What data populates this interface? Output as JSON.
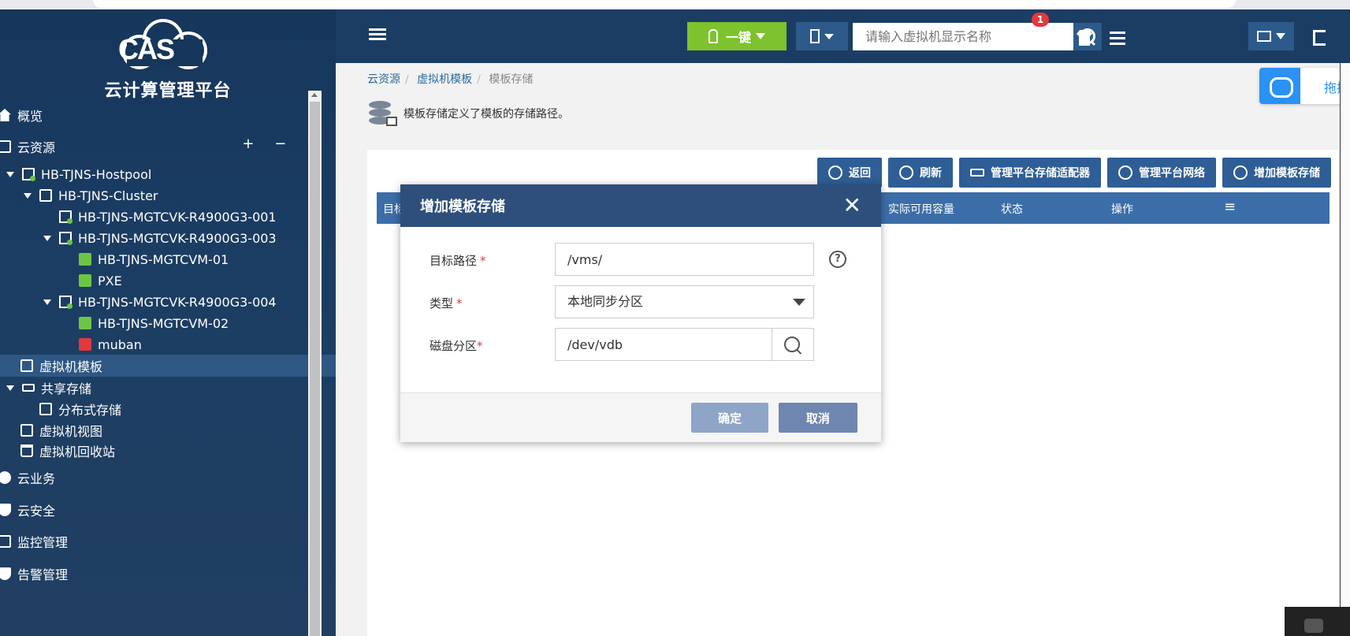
{
  "app": {
    "logo_text": "CAS",
    "subtitle": "云计算管理平台"
  },
  "header": {
    "one_key_label": "一键",
    "search_placeholder": "请输入虚拟机显示名称",
    "alert_count": "1"
  },
  "sidebar": {
    "overview": "概览",
    "cloud_resources": "云资源",
    "hostpool": "HB-TJNS-Hostpool",
    "cluster": "HB-TJNS-Cluster",
    "host1": "HB-TJNS-MGTCVK-R4900G3-001",
    "host2": "HB-TJNS-MGTCVK-R4900G3-003",
    "vm1": "HB-TJNS-MGTCVM-01",
    "vm2": "PXE",
    "host3": "HB-TJNS-MGTCVK-R4900G3-004",
    "vm3": "HB-TJNS-MGTCVM-02",
    "vm4": "muban",
    "vm_templates": "虚拟机模板",
    "shared_storage": "共享存储",
    "distributed_storage": "分布式存储",
    "vm_view": "虚拟机视图",
    "vm_recycle": "虚拟机回收站",
    "cloud_business": "云业务",
    "cloud_security": "云安全",
    "monitoring": "监控管理",
    "alarm": "告警管理"
  },
  "breadcrumb": {
    "level1": "云资源",
    "level2": "虚拟机模板",
    "level3": "模板存储"
  },
  "page": {
    "description": "模板存储定义了模板的存储路径。"
  },
  "toolbar": {
    "back": "返回",
    "refresh": "刷新",
    "storage_adapter": "管理平台存储适配器",
    "network": "管理平台网络",
    "add_template_storage": "增加模板存储"
  },
  "table": {
    "col_target": "目标",
    "col_available": "实际可用容量",
    "col_status": "状态",
    "col_action": "操作"
  },
  "modal": {
    "title": "增加模板存储",
    "target_path_label": "目标路径",
    "target_path_value": "/vms/",
    "type_label": "类型",
    "type_value": "本地同步分区",
    "disk_partition_label": "磁盘分区",
    "disk_partition_value": "/dev/vdb",
    "required_mark": "*",
    "ok_label": "确定",
    "cancel_label": "取消",
    "help_glyph": "?"
  },
  "float_widget": {
    "label": "拖拽"
  },
  "colors": {
    "sidebar_bg": "#1c3d63",
    "accent_green": "#7dc32d",
    "header_blue": "#2e5e95",
    "modal_header": "#2e4f7b"
  }
}
